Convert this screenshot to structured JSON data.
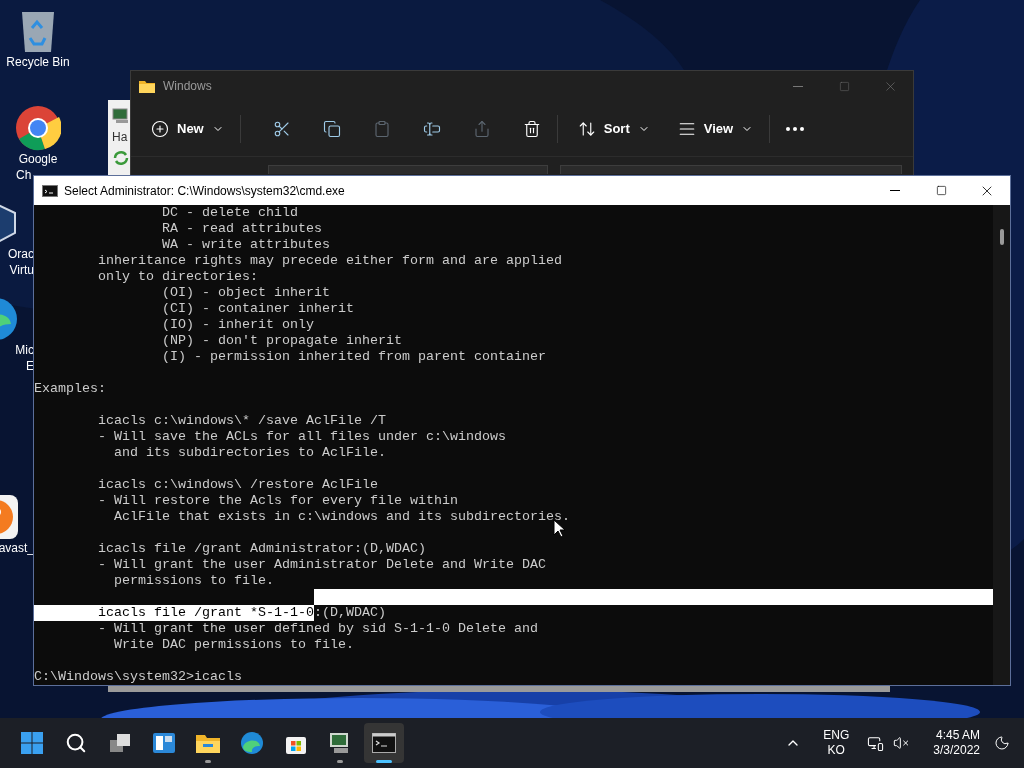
{
  "desktop_icons": [
    {
      "kind": "recycle",
      "lines": [
        "Recycle Bin"
      ]
    },
    {
      "kind": "chrome",
      "lines": [
        "Google",
        "Ch"
      ]
    },
    {
      "kind": "virtualbox",
      "lines": [
        "Orac",
        "Virtu"
      ]
    },
    {
      "kind": "edge",
      "lines": [
        "Mic",
        "E"
      ]
    },
    {
      "kind": "avast",
      "lines": [
        "avast_"
      ]
    }
  ],
  "back_window": {
    "label": "Ha"
  },
  "explorer": {
    "title": "Windows",
    "toolbar": [
      {
        "kind": "new",
        "label": "New",
        "disabled": false
      },
      {
        "kind": "separator"
      },
      {
        "kind": "cut",
        "disabled": false
      },
      {
        "kind": "copy",
        "disabled": false
      },
      {
        "kind": "paste",
        "disabled": true
      },
      {
        "kind": "rename",
        "disabled": false
      },
      {
        "kind": "share",
        "disabled": true
      },
      {
        "kind": "delete",
        "disabled": false
      },
      {
        "kind": "separator"
      },
      {
        "kind": "sort",
        "label": "Sort",
        "disabled": false
      },
      {
        "kind": "view",
        "label": "View",
        "disabled": false
      },
      {
        "kind": "separator"
      },
      {
        "kind": "more",
        "disabled": false
      }
    ]
  },
  "console": {
    "title": "Select Administrator: C:\\Windows\\system32\\cmd.exe",
    "lines": [
      {
        "text": "                DC - delete child",
        "selected": false
      },
      {
        "text": "                RA - read attributes",
        "selected": false
      },
      {
        "text": "                WA - write attributes",
        "selected": false
      },
      {
        "text": "        inheritance rights may precede either form and are applied",
        "selected": false
      },
      {
        "text": "        only to directories:",
        "selected": false
      },
      {
        "text": "                (OI) - object inherit",
        "selected": false
      },
      {
        "text": "                (CI) - container inherit",
        "selected": false
      },
      {
        "text": "                (IO) - inherit only",
        "selected": false
      },
      {
        "text": "                (NP) - don't propagate inherit",
        "selected": false
      },
      {
        "text": "                (I) - permission inherited from parent container",
        "selected": false
      },
      {
        "selected": false
      },
      {
        "text": "Examples:",
        "selected": false
      },
      {
        "selected": false
      },
      {
        "text": "        icacls c:\\windows\\* /save AclFile /T",
        "selected": false
      },
      {
        "text": "        - Will save the ACLs for all files under c:\\windows",
        "selected": false
      },
      {
        "text": "          and its subdirectories to AclFile.",
        "selected": false
      },
      {
        "selected": false
      },
      {
        "text": "        icacls c:\\windows\\ /restore AclFile",
        "selected": false
      },
      {
        "text": "        - Will restore the Acls for every file within",
        "selected": false
      },
      {
        "text": "          AclFile that exists in c:\\windows and its subdirectories.",
        "selected": false
      },
      {
        "selected": false
      },
      {
        "text": "        icacls file /grant Administrator:(D,WDAC)",
        "selected": false
      },
      {
        "text": "        - Will grant the user Administrator Delete and Write DAC",
        "selected": false
      },
      {
        "text": "          permissions to file.",
        "selected": false
      },
      {
        "selected": true
      },
      {
        "selected": true,
        "selected_text": "        icacls file /grant *S-1-1-0",
        "text": ":(D,WDAC)"
      },
      {
        "text": "        - Will grant the user defined by sid S-1-1-0 Delete and",
        "selected": false
      },
      {
        "text": "          Write DAC permissions to file.",
        "selected": false
      },
      {
        "selected": false
      },
      {
        "text": "C:\\Windows\\system32>icacls",
        "selected": false
      }
    ]
  },
  "taskbar": {
    "apps": [
      {
        "kind": "start",
        "running": false,
        "selected": false
      },
      {
        "kind": "search",
        "running": false,
        "selected": false
      },
      {
        "kind": "taskview",
        "running": false,
        "selected": false
      },
      {
        "kind": "widgets",
        "running": false,
        "selected": false
      },
      {
        "kind": "explorer",
        "running": true,
        "selected": false
      },
      {
        "kind": "edge",
        "running": false,
        "selected": false
      },
      {
        "kind": "store",
        "running": false,
        "selected": false
      },
      {
        "kind": "computer",
        "running": true,
        "selected": false
      },
      {
        "kind": "terminal",
        "running": true,
        "selected": true
      }
    ],
    "language": [
      "ENG",
      "KO"
    ],
    "time": "4:45 AM",
    "date": "3/3/2022"
  }
}
